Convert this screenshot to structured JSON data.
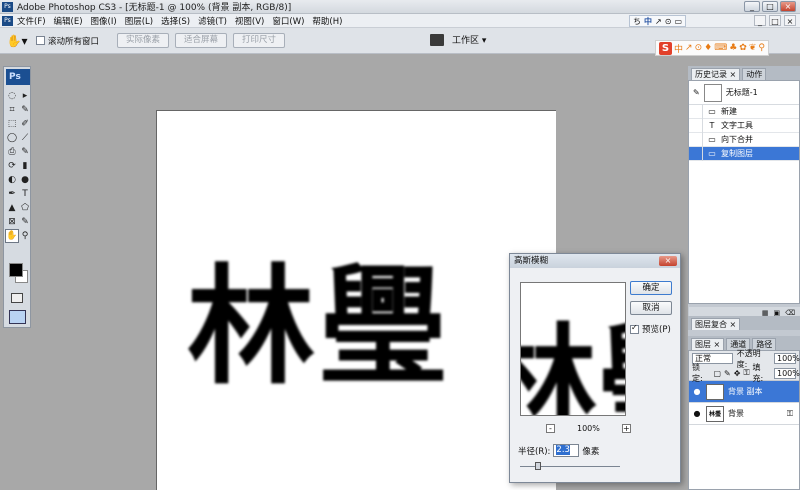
{
  "window": {
    "title": "Adobe Photoshop CS3 - [无标题-1 @ 100% (背景 副本, RGB/8)]",
    "app_badge": "Ps",
    "minimize": "_",
    "maximize": "□",
    "close": "×"
  },
  "menu": {
    "items": [
      "文件(F)",
      "编辑(E)",
      "图像(I)",
      "图层(L)",
      "选择(S)",
      "滤镜(T)",
      "视图(V)",
      "窗口(W)",
      "帮助(H)"
    ],
    "doc_min": "_",
    "doc_max": "□",
    "doc_close": "×"
  },
  "ime": {
    "items": [
      "ち",
      "中",
      "↗",
      "⊙",
      "▭"
    ]
  },
  "options": {
    "tool_icon": "hand-icon",
    "scroll_all_label": "滚动所有窗口",
    "btn_actual_pixels": "实际像素",
    "btn_fit_screen": "适合屏幕",
    "btn_print_size": "打印尺寸",
    "workspace_label": "工作区 ▾"
  },
  "sogou": {
    "logo": "S",
    "items": [
      "中",
      "↗",
      "⊙",
      "♦",
      "⌨",
      "♣",
      "✿",
      "❦",
      "⚲"
    ]
  },
  "toolbox": {
    "logo": "Ps",
    "tools": [
      "◌",
      "▸",
      "⌗",
      "✎",
      "⬚",
      "✐",
      "◯",
      "⟋",
      "⎙",
      "✎",
      "⟳",
      "▮",
      "◐",
      "●",
      "✒",
      "T",
      "▲",
      "⬠",
      "⊠",
      "✎",
      "✋",
      "⚲"
    ]
  },
  "canvas": {
    "text": "林璺"
  },
  "dialog": {
    "title": "高斯模糊",
    "close": "×",
    "preview_text": "林璺",
    "ok": "确定",
    "cancel": "取消",
    "preview_label": "预览(P)",
    "zoom_minus": "-",
    "zoom_value": "100%",
    "zoom_plus": "+",
    "radius_label": "半径(R):",
    "radius_value": "2.3",
    "radius_unit": "像素",
    "radius_slider_fraction": 0.15
  },
  "history_panel": {
    "tabs": [
      "历史记录 ×",
      "动作"
    ],
    "snapshot_label": "无标题-1",
    "rows": [
      {
        "icon": "▭",
        "label": "新建"
      },
      {
        "icon": "T",
        "label": "文字工具"
      },
      {
        "icon": "▭",
        "label": "向下合并"
      },
      {
        "icon": "▭",
        "label": "复制图层"
      }
    ],
    "selected_index": 3,
    "footer_icons": [
      "▦",
      "▣",
      "⌫"
    ]
  },
  "navigator_panel": {
    "tabs": [
      "图层复合 ×"
    ]
  },
  "layers_panel": {
    "tabs": [
      "图层 ×",
      "通道",
      "路径"
    ],
    "blend_mode": "正常",
    "opacity_label": "不透明度:",
    "opacity_value": "100%",
    "lock_label": "锁定:",
    "fill_label": "填充:",
    "fill_value": "100%",
    "layers": [
      {
        "name": "背景 副本",
        "thumb": "林璺",
        "selected": true,
        "locked": false
      },
      {
        "name": "背景",
        "thumb": "林璺",
        "selected": false,
        "locked": true
      }
    ]
  }
}
